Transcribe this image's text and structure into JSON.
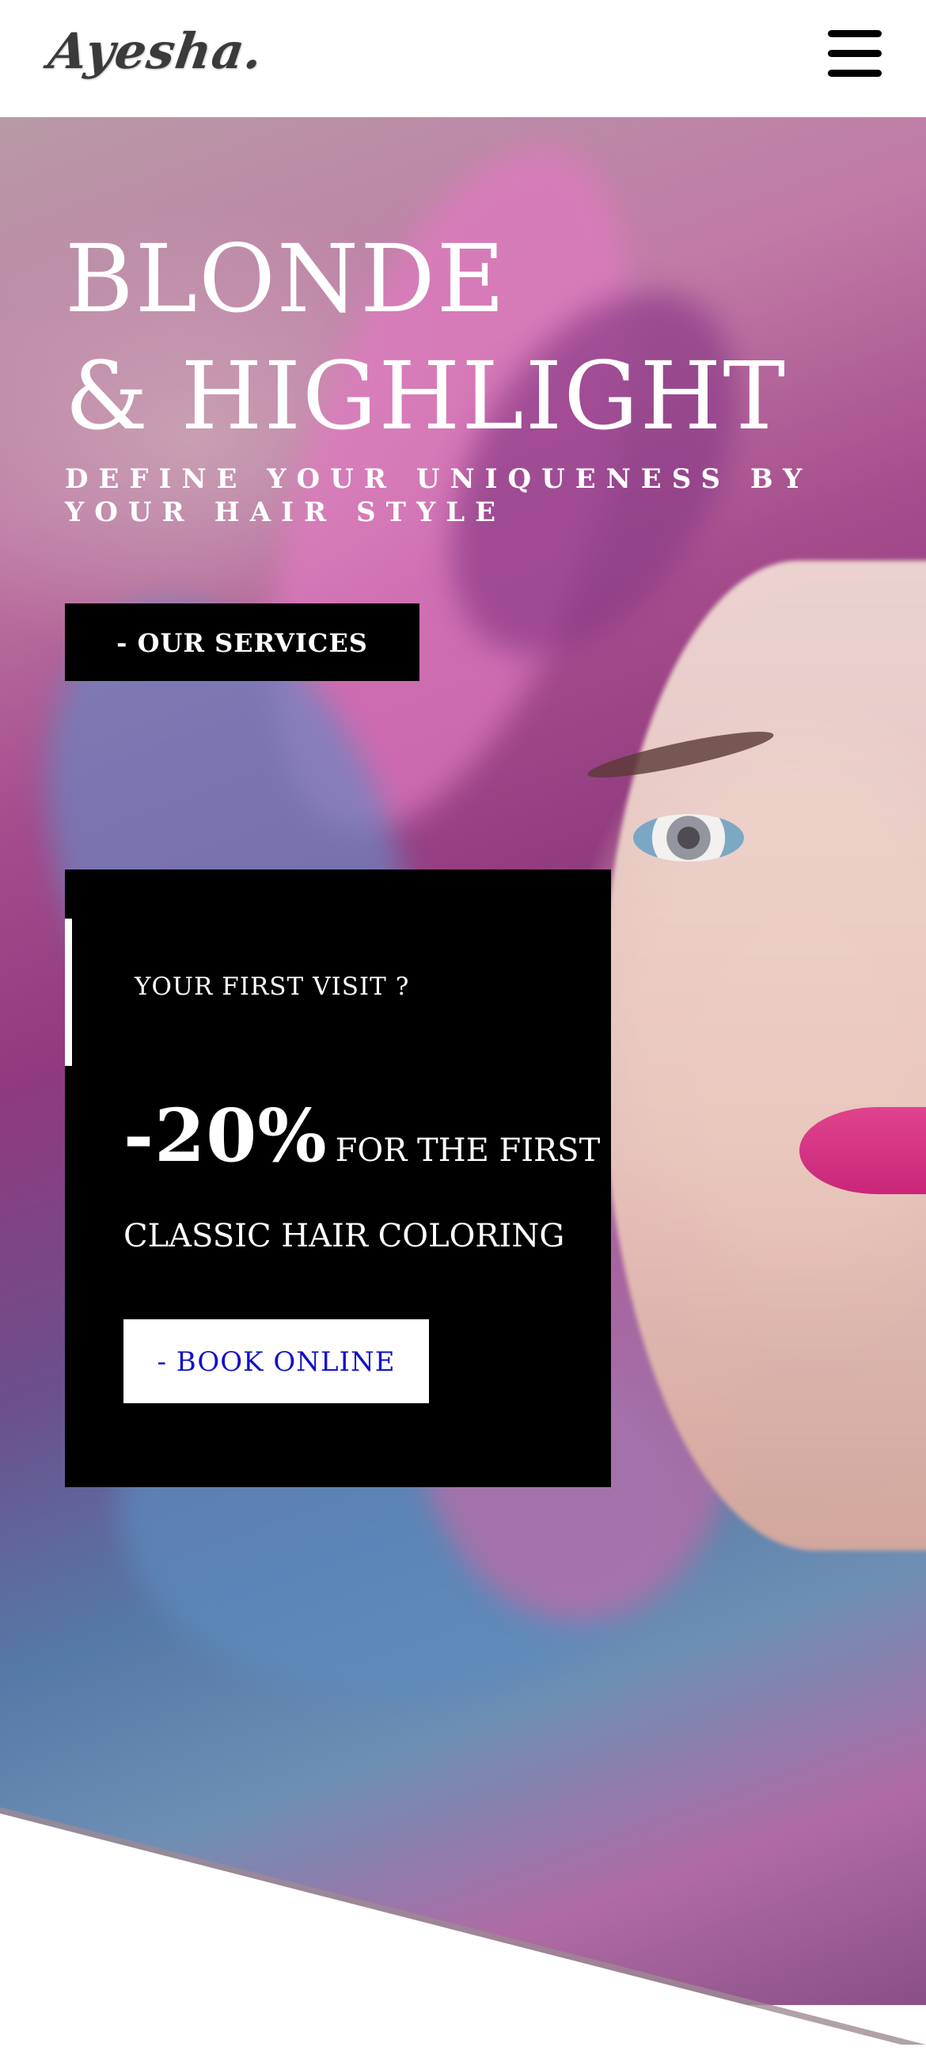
{
  "header": {
    "logo": "Ayesha.",
    "menu_icon": "hamburger-menu-icon"
  },
  "hero": {
    "title_line1": "BLONDE",
    "title_line2": "& HIGHLIGHT",
    "tagline": "DEFINE YOUR UNIQUENESS BY YOUR HAIR STYLE",
    "services_button": "- OUR SERVICES"
  },
  "promo": {
    "eyebrow": "YOUR FIRST VISIT ?",
    "discount": "-20%",
    "line1_text": "FOR THE FIRST",
    "line2_text": "CLASSIC HAIR COLORING",
    "book_button": "- BOOK ONLINE"
  },
  "colors": {
    "card_background": "#000000",
    "book_button_text": "#1010c8",
    "hero_text": "#ffffff"
  }
}
